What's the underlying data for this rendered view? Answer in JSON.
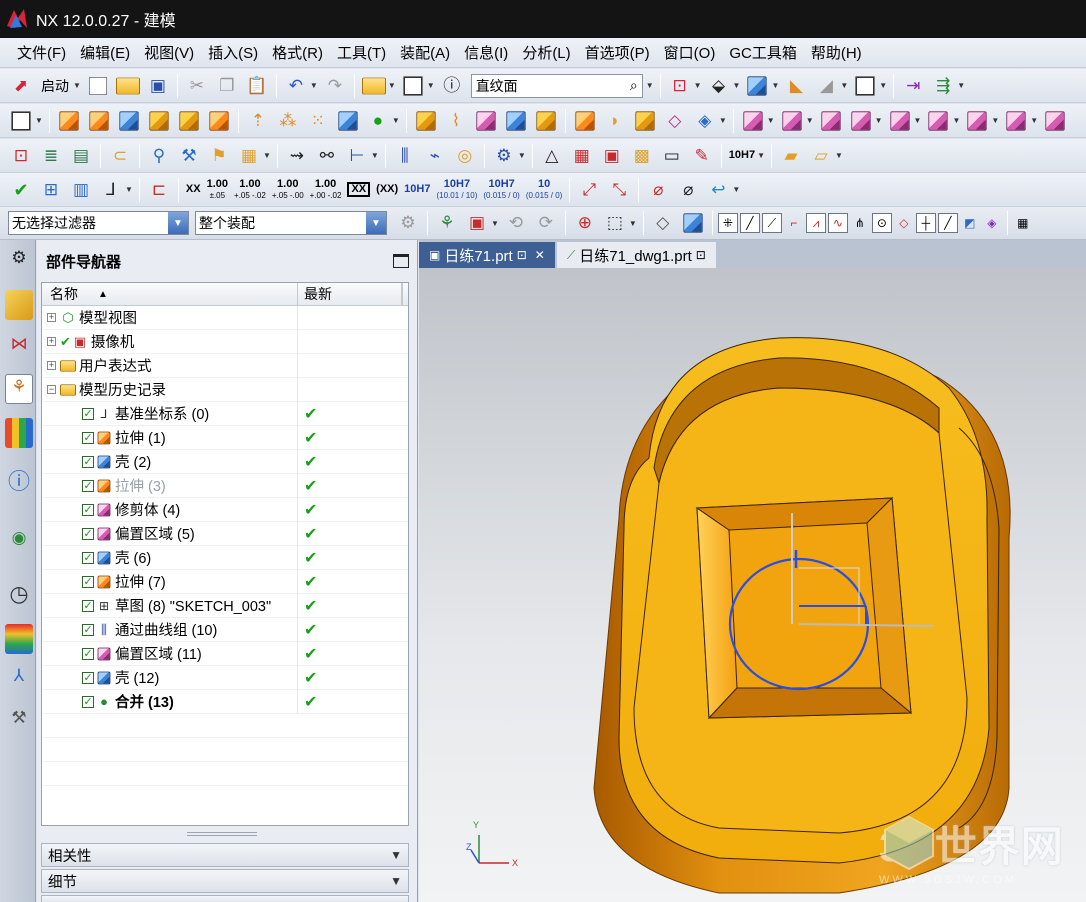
{
  "window": {
    "title": "NX 12.0.0.27 - 建模"
  },
  "menu": [
    "文件(F)",
    "编辑(E)",
    "视图(V)",
    "插入(S)",
    "格式(R)",
    "工具(T)",
    "装配(A)",
    "信息(I)",
    "分析(L)",
    "首选项(P)",
    "窗口(O)",
    "GC工具箱",
    "帮助(H)"
  ],
  "toolbar": {
    "start_label": "启动",
    "surface_search": "直纹面",
    "tolerances": [
      {
        "top": "XX",
        "bottom": ""
      },
      {
        "top": "1.00",
        "bottom": "±.05"
      },
      {
        "top": "1.00",
        "bottom": "+.05 -.02"
      },
      {
        "top": "1.00",
        "bottom": "+.05 -.00"
      },
      {
        "top": "1.00",
        "bottom": "+.00 -.02"
      },
      {
        "top": "XX",
        "bottom": ""
      },
      {
        "top": "(XX)",
        "bottom": ""
      },
      {
        "top": "10H7",
        "bottom": ""
      },
      {
        "top": "10H7",
        "bottom": "(10.01 / 10)"
      },
      {
        "top": "10H7",
        "bottom": "(0.015 / 0)"
      },
      {
        "top": "10",
        "bottom": "(0.015 / 0)"
      }
    ],
    "fit_label": "10H7"
  },
  "filter": {
    "selection_filter": "无选择过滤器",
    "assembly_scope": "整个装配"
  },
  "navigator": {
    "title": "部件导航器",
    "columns": {
      "name": "名称",
      "latest": "最新"
    },
    "top_nodes": [
      {
        "label": "模型视图",
        "icon": "model-views-icon"
      },
      {
        "label": "摄像机",
        "icon": "camera-icon"
      },
      {
        "label": "用户表达式",
        "icon": "folder-icon"
      },
      {
        "label": "模型历史记录",
        "icon": "folder-open-icon"
      }
    ],
    "features": [
      {
        "label": "基准坐标系 (0)",
        "icon": "datum-csys-icon",
        "latest": "✔",
        "style": "normal"
      },
      {
        "label": "拉伸 (1)",
        "icon": "extrude-icon",
        "latest": "✔",
        "style": "normal"
      },
      {
        "label": "壳 (2)",
        "icon": "shell-icon",
        "latest": "✔",
        "style": "normal"
      },
      {
        "label": "拉伸 (3)",
        "icon": "extrude-icon",
        "latest": "✔",
        "style": "dim"
      },
      {
        "label": "修剪体 (4)",
        "icon": "trim-body-icon",
        "latest": "✔",
        "style": "normal"
      },
      {
        "label": "偏置区域 (5)",
        "icon": "offset-region-icon",
        "latest": "✔",
        "style": "normal"
      },
      {
        "label": "壳 (6)",
        "icon": "shell-icon",
        "latest": "✔",
        "style": "normal"
      },
      {
        "label": "拉伸 (7)",
        "icon": "extrude-icon",
        "latest": "✔",
        "style": "normal"
      },
      {
        "label": "草图 (8) \"SKETCH_003\"",
        "icon": "sketch-icon",
        "latest": "✔",
        "style": "normal"
      },
      {
        "label": "通过曲线组 (10)",
        "icon": "through-curves-icon",
        "latest": "✔",
        "style": "normal"
      },
      {
        "label": "偏置区域 (11)",
        "icon": "offset-region-icon",
        "latest": "✔",
        "style": "normal"
      },
      {
        "label": "壳 (12)",
        "icon": "shell-icon",
        "latest": "✔",
        "style": "normal"
      },
      {
        "label": "合并 (13)",
        "icon": "unite-icon",
        "latest": "✔",
        "style": "bold"
      }
    ],
    "panels": [
      "相关性",
      "细节"
    ]
  },
  "tabs": [
    {
      "label": "日练71.prt",
      "active": true
    },
    {
      "label": "日练71_dwg1.prt",
      "active": false
    }
  ],
  "graphics": {
    "view_triad": {
      "x": "X",
      "y": "Y",
      "z": "Z"
    },
    "watermark": {
      "main": "3D世界网",
      "sub": "WWW.3DSJW.COM"
    }
  },
  "colors": {
    "titlebar": "#141414",
    "model_face": "#f6b516",
    "model_side": "#d9850d",
    "active_tab": "#3d5f94",
    "sketch_curve": "#2a4fe0"
  }
}
